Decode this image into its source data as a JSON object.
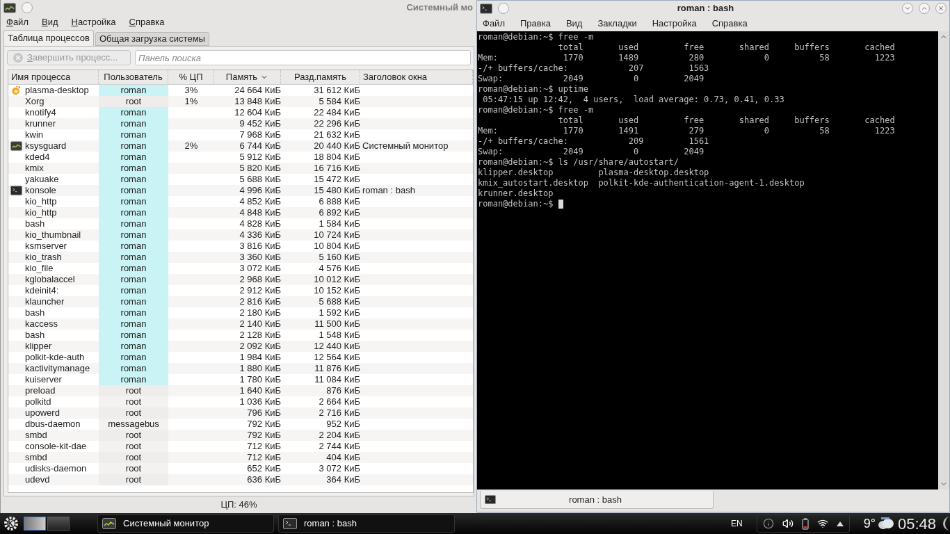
{
  "monitor": {
    "title": "Системный мо",
    "menu": [
      "Файл",
      "Вид",
      "Настройка",
      "Справка"
    ],
    "tabs": [
      {
        "label": "Таблица процессов",
        "selected": true
      },
      {
        "label": "Общая загрузка системы",
        "selected": false
      }
    ],
    "kill_button": {
      "label": "Завершить процесс...",
      "disabled": true
    },
    "search": {
      "placeholder": "Панель поиска"
    },
    "columns": [
      {
        "label": "Имя процесса",
        "sorted": false
      },
      {
        "label": "Пользователь",
        "sorted": false
      },
      {
        "label": "% ЦП",
        "sorted": false
      },
      {
        "label": "Память",
        "sorted": true
      },
      {
        "label": "Разд.память",
        "sorted": false
      },
      {
        "label": "Заголовок окна",
        "sorted": false
      }
    ],
    "rows": [
      {
        "kind": "plasma",
        "name": "plasma-desktop",
        "user": "roman",
        "own": true,
        "cpu": "3%",
        "memory": "24 664 КиБ",
        "shared": "31 612 КиБ"
      },
      {
        "kind": "plain",
        "name": "Xorg",
        "user": "root",
        "own": false,
        "cpu": "1%",
        "memory": "13 848 КиБ",
        "shared": "5 584 КиБ"
      },
      {
        "kind": "plain",
        "name": "knotify4",
        "user": "roman",
        "own": true,
        "memory": "12 604 КиБ",
        "shared": "22 484 КиБ"
      },
      {
        "kind": "plain",
        "name": "krunner",
        "user": "roman",
        "own": true,
        "memory": "9 452 КиБ",
        "shared": "22 296 КиБ"
      },
      {
        "kind": "plain",
        "name": "kwin",
        "user": "roman",
        "own": true,
        "memory": "7 968 КиБ",
        "shared": "21 632 КиБ"
      },
      {
        "kind": "monitor",
        "name": "ksysguard",
        "user": "roman",
        "own": true,
        "cpu": "2%",
        "memory": "6 744 КиБ",
        "shared": "20 440 КиБ",
        "window": "Системный монитор"
      },
      {
        "kind": "plain",
        "name": "kded4",
        "user": "roman",
        "own": true,
        "memory": "5 912 КиБ",
        "shared": "18 804 КиБ"
      },
      {
        "kind": "plain",
        "name": "kmix",
        "user": "roman",
        "own": true,
        "memory": "5 820 КиБ",
        "shared": "16 716 КиБ"
      },
      {
        "kind": "plain",
        "name": "yakuake",
        "user": "roman",
        "own": true,
        "memory": "5 688 КиБ",
        "shared": "15 472 КиБ"
      },
      {
        "kind": "terminal",
        "name": "konsole",
        "user": "roman",
        "own": true,
        "memory": "4 996 КиБ",
        "shared": "15 480 КиБ",
        "window": "roman : bash"
      },
      {
        "kind": "plain",
        "name": "kio_http",
        "user": "roman",
        "own": true,
        "memory": "4 852 КиБ",
        "shared": "6 888 КиБ"
      },
      {
        "kind": "plain",
        "name": "kio_http",
        "user": "roman",
        "own": true,
        "memory": "4 848 КиБ",
        "shared": "6 892 КиБ"
      },
      {
        "kind": "plain",
        "name": "bash",
        "user": "roman",
        "own": true,
        "memory": "4 828 КиБ",
        "shared": "1 584 КиБ"
      },
      {
        "kind": "plain",
        "name": "kio_thumbnail",
        "user": "roman",
        "own": true,
        "memory": "4 336 КиБ",
        "shared": "10 724 КиБ"
      },
      {
        "kind": "plain",
        "name": "ksmserver",
        "user": "roman",
        "own": true,
        "memory": "3 816 КиБ",
        "shared": "10 804 КиБ"
      },
      {
        "kind": "plain",
        "name": "kio_trash",
        "user": "roman",
        "own": true,
        "memory": "3 360 КиБ",
        "shared": "5 160 КиБ"
      },
      {
        "kind": "plain",
        "name": "kio_file",
        "user": "roman",
        "own": true,
        "memory": "3 072 КиБ",
        "shared": "4 576 КиБ"
      },
      {
        "kind": "plain",
        "name": "kglobalaccel",
        "user": "roman",
        "own": true,
        "memory": "2 968 КиБ",
        "shared": "10 012 КиБ"
      },
      {
        "kind": "plain",
        "name": "kdeinit4:",
        "user": "roman",
        "own": true,
        "memory": "2 912 КиБ",
        "shared": "10 152 КиБ"
      },
      {
        "kind": "plain",
        "name": "klauncher",
        "user": "roman",
        "own": true,
        "memory": "2 816 КиБ",
        "shared": "5 688 КиБ"
      },
      {
        "kind": "plain",
        "name": "bash",
        "user": "roman",
        "own": true,
        "memory": "2 180 КиБ",
        "shared": "1 592 КиБ"
      },
      {
        "kind": "plain",
        "name": "kaccess",
        "user": "roman",
        "own": true,
        "memory": "2 140 КиБ",
        "shared": "11 500 КиБ"
      },
      {
        "kind": "plain",
        "name": "bash",
        "user": "roman",
        "own": true,
        "memory": "2 128 КиБ",
        "shared": "1 548 КиБ"
      },
      {
        "kind": "plain",
        "name": "klipper",
        "user": "roman",
        "own": true,
        "memory": "2 092 КиБ",
        "shared": "12 440 КиБ"
      },
      {
        "kind": "plain",
        "name": "polkit-kde-auth",
        "user": "roman",
        "own": true,
        "memory": "1 984 КиБ",
        "shared": "12 564 КиБ"
      },
      {
        "kind": "plain",
        "name": "kactivitymanage",
        "user": "roman",
        "own": true,
        "memory": "1 880 КиБ",
        "shared": "11 876 КиБ"
      },
      {
        "kind": "plain",
        "name": "kuiserver",
        "user": "roman",
        "own": true,
        "memory": "1 780 КиБ",
        "shared": "11 084 КиБ"
      },
      {
        "kind": "plain",
        "name": "preload",
        "user": "root",
        "own": false,
        "memory": "1 640 КиБ",
        "shared": "876 КиБ"
      },
      {
        "kind": "plain",
        "name": "polkitd",
        "user": "root",
        "own": false,
        "memory": "1 036 КиБ",
        "shared": "2 664 КиБ"
      },
      {
        "kind": "plain",
        "name": "upowerd",
        "user": "root",
        "own": false,
        "memory": "796 КиБ",
        "shared": "2 716 КиБ"
      },
      {
        "kind": "plain",
        "name": "dbus-daemon",
        "user": "messagebus",
        "own": false,
        "memory": "792 КиБ",
        "shared": "952 КиБ"
      },
      {
        "kind": "plain",
        "name": "smbd",
        "user": "root",
        "own": false,
        "memory": "792 КиБ",
        "shared": "2 204 КиБ"
      },
      {
        "kind": "plain",
        "name": "console-kit-dae",
        "user": "root",
        "own": false,
        "memory": "712 КиБ",
        "shared": "2 744 КиБ"
      },
      {
        "kind": "plain",
        "name": "smbd",
        "user": "root",
        "own": false,
        "memory": "712 КиБ",
        "shared": "404 КиБ"
      },
      {
        "kind": "plain",
        "name": "udisks-daemon",
        "user": "root",
        "own": false,
        "memory": "652 КиБ",
        "shared": "3 072 КиБ"
      },
      {
        "kind": "plain",
        "name": "udevd",
        "user": "root",
        "own": false,
        "memory": "636 КиБ",
        "shared": "364 КиБ"
      }
    ],
    "status": "ЦП: 46%"
  },
  "terminal": {
    "title": "roman : bash",
    "menu": [
      "Файл",
      "Правка",
      "Вид",
      "Закладки",
      "Настройка",
      "Справка"
    ],
    "lines": [
      "roman@debian:~$ free -m",
      "                total       used         free       shared     buffers       cached",
      "Mem:             1770       1489          280            0          58         1223",
      "-/+ buffers/cache:            207         1563",
      "Swap:            2049          0         2049",
      "roman@debian:~$ uptime",
      " 05:47:15 up 12:42,  4 users,  load average: 0.73, 0.41, 0.33",
      "roman@debian:~$ free -m",
      "                total       used         free       shared     buffers       cached",
      "Mem:             1770       1491          279            0          58         1223",
      "-/+ buffers/cache:            209         1561",
      "Swap:            2049          0         2049",
      "roman@debian:~$ ls /usr/share/autostart/",
      "klipper.desktop         plasma-desktop.desktop",
      "kmix_autostart.desktop  polkit-kde-authentication-agent-1.desktop",
      "krunner.desktop",
      "roman@debian:~$ "
    ],
    "tabs": [
      {
        "label": "roman : bash",
        "selected": true
      }
    ]
  },
  "taskbar": {
    "pager": [
      {
        "selected": true
      },
      {
        "selected": false
      }
    ],
    "tasks": [
      {
        "kind": "monitor",
        "label": "Системный монитор"
      },
      {
        "kind": "terminal",
        "label": "roman : bash"
      }
    ],
    "layout": "EN",
    "temperature": "9°",
    "clock": "05:48"
  }
}
